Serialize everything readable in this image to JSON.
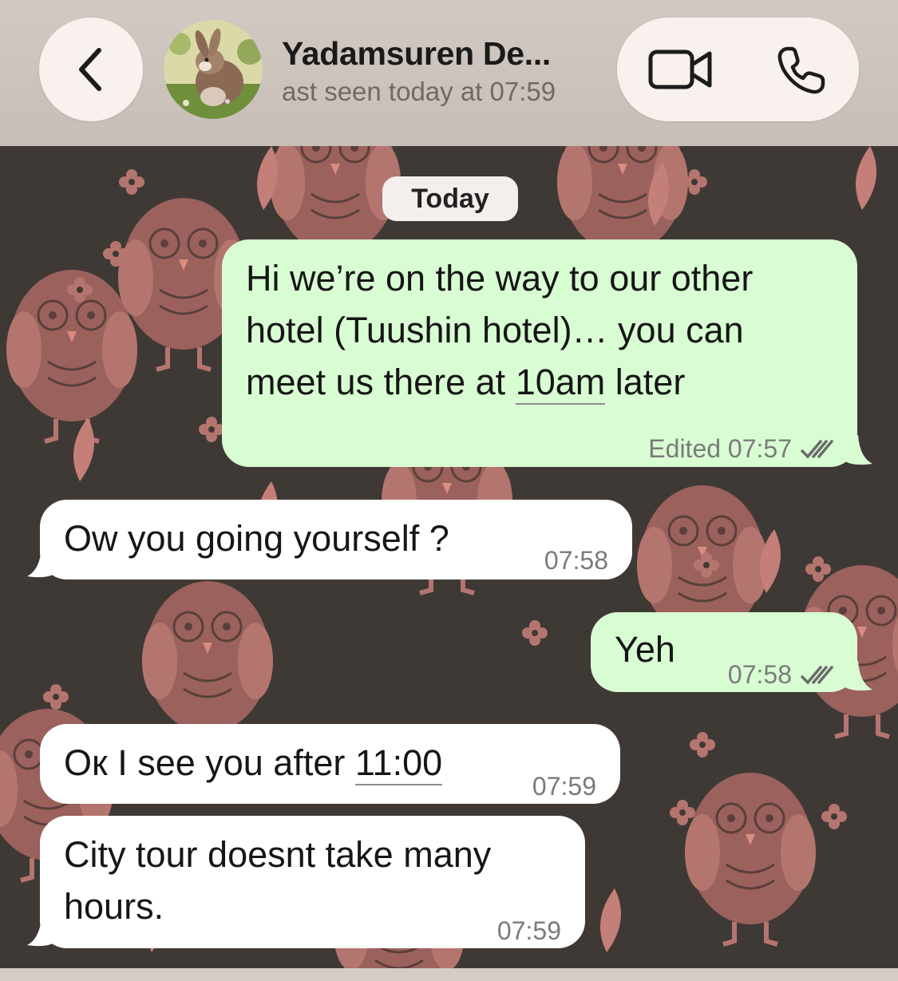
{
  "header": {
    "back_label": "back",
    "contact_name": "Yadamsuren De...",
    "status": "ast seen today at 07:59"
  },
  "chat": {
    "date_separator": "Today",
    "messages": [
      {
        "direction": "outgoing",
        "lines": [
          "Hi we’re on the way to our other",
          "hotel (Tuushin hotel)… you can",
          "meet us there at "
        ],
        "link_text": "10am",
        "line3_tail": " later",
        "edited_label": "Edited",
        "time": "07:57",
        "status": "read"
      },
      {
        "direction": "incoming",
        "text": "Ow you going yourself ?",
        "time": "07:58"
      },
      {
        "direction": "outgoing",
        "text": "Yeh",
        "time": "07:58",
        "status": "read"
      },
      {
        "direction": "incoming",
        "text_prefix": "Oк I see you after ",
        "link_text": "11:00",
        "time": "07:59"
      },
      {
        "direction": "incoming",
        "lines": [
          "City tour doesnt take many",
          "hours."
        ],
        "time": "07:59"
      }
    ]
  },
  "colors": {
    "outgoing_bubble": "#d9fdd3",
    "incoming_bubble": "#ffffff",
    "header_bg": "#cdc4be",
    "wallpaper_bg": "#3f3936",
    "owl_pink": "#b0726c"
  },
  "icons": {
    "back": "chevron-left-icon",
    "video": "video-camera-icon",
    "phone": "phone-icon",
    "read_receipt": "double-check-icon"
  }
}
